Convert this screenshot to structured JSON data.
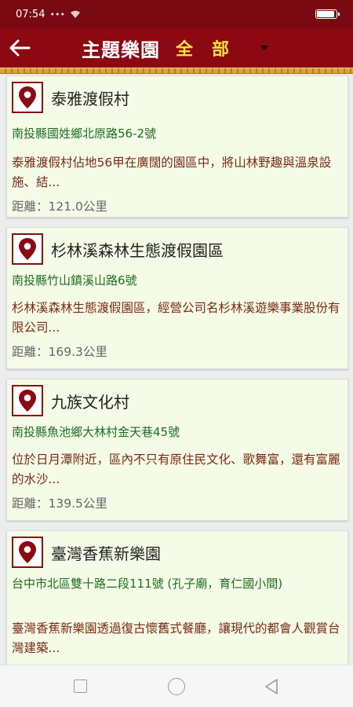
{
  "status_bar": {
    "time": "07:54",
    "indicator_dots": "•••",
    "wifi_icon": "wifi-icon",
    "battery_icon": "battery-icon"
  },
  "app_bar": {
    "back_icon": "arrow-left-icon",
    "title": "主題樂園",
    "filter_value": "全部",
    "filter_icon": "caret-down-icon",
    "bar_color": "#8c0812"
  },
  "places": [
    {
      "name": "泰雅渡假村",
      "address": "南投縣國姓鄉北原路56-2號",
      "description": "泰雅渡假村佔地56甲在廣闊的園區中，將山林野趣與溫泉設施、結...",
      "distance": "距離：121.0公里"
    },
    {
      "name": "杉林溪森林生態渡假園區",
      "address": "南投縣竹山鎮溪山路6號",
      "description": "杉林溪森林生態渡假園區，經營公司名杉林溪遊樂事業股份有限公司...",
      "distance": "距離：169.3公里"
    },
    {
      "name": "九族文化村",
      "address": "南投縣魚池鄉大林村金天巷45號",
      "description": "位於日月潭附近，區內不只有原住民文化、歌舞富，還有富麗的水沙...",
      "distance": "距離：139.5公里"
    },
    {
      "name": "臺灣香蕉新樂園",
      "address": "台中市北區雙十路二段111號 (孔子廟，育仁國小間)",
      "description": "臺灣香蕉新樂園透過復古懷舊式餐廳，讓現代的都會人觀賞台灣建築...",
      "distance": ""
    }
  ],
  "nav_bar": {
    "recents_icon": "square-icon",
    "home_icon": "circle-icon",
    "back_icon": "triangle-back-icon"
  },
  "colors": {
    "pin": "#8a0b14",
    "address": "#1f6b22",
    "description": "#7a2a16",
    "card_bg": "#f4fbe6",
    "filter": "#ffe23a"
  }
}
